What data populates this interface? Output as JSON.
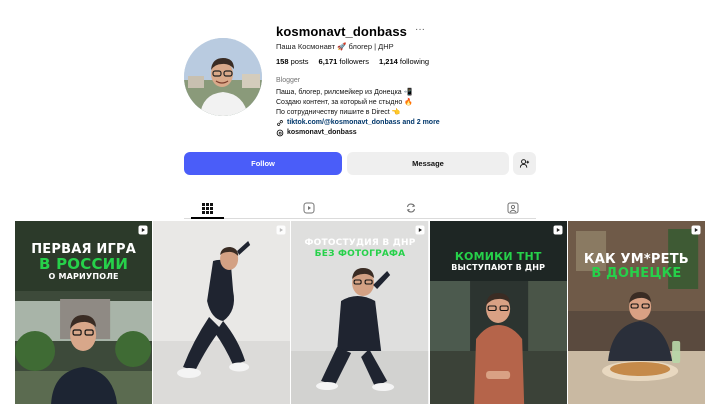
{
  "profile": {
    "username": "kosmonavt_donbass",
    "more_label": "···",
    "full_name": "Паша Космонавт 🚀 блогер | ДНР",
    "stats": {
      "posts_count": "158",
      "posts_label": "posts",
      "followers_count": "6,171",
      "followers_label": "followers",
      "following_count": "1,214",
      "following_label": "following"
    },
    "category": "Blogger",
    "bio_lines": [
      "Паша, блогер, рилсмейкер из Донецка 📲",
      "Создаю контент, за который не стыдно 🔥",
      "По сотрудничеству пишите в Direct 👈"
    ],
    "link_text": "tiktok.com/@kosmonavt_donbass and 2 more",
    "threads_text": "kosmonavt_donbass"
  },
  "actions": {
    "follow_label": "Follow",
    "message_label": "Message"
  },
  "tabs": [
    {
      "icon": "grid-icon",
      "active": true
    },
    {
      "icon": "reels-icon",
      "active": false
    },
    {
      "icon": "reposts-icon",
      "active": false
    },
    {
      "icon": "tagged-icon",
      "active": false
    }
  ],
  "posts": [
    {
      "line1": "Первая игра",
      "line2": "в России",
      "line3": "о Мариуполе",
      "icon": "reel-icon"
    },
    {
      "icon": "reel-icon"
    },
    {
      "line1": "Фотостудия в ДНР",
      "line2": "без фотографа",
      "icon": "reel-icon"
    },
    {
      "line1": "Комики ТНТ",
      "line2": "выступают в ДНР",
      "icon": "reel-icon"
    },
    {
      "line1": "Как ум*реть",
      "line2": "в Донецке",
      "icon": "reel-icon"
    }
  ],
  "colors": {
    "follow_button": "#4a5df9",
    "secondary_button": "#efefef",
    "accent_green": "#26d14a",
    "link": "#00376b"
  }
}
